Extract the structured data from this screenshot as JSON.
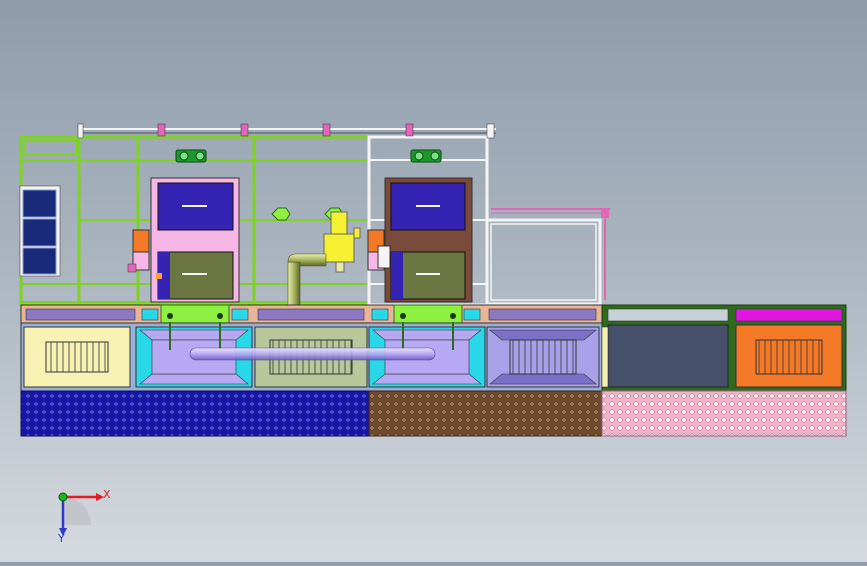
{
  "view": {
    "background_top": "#8e9cab",
    "background_bottom": "#d6dadf"
  },
  "triad": {
    "x_label": "X",
    "y_label": "Y",
    "x_color": "#e02020",
    "y_color": "#2a3bd0",
    "origin_color": "#1fb31f"
  },
  "colors": {
    "frame_green": "#7ed321",
    "frame_dark_green": "#2e6b1e",
    "frame_white": "#f4f4f4",
    "frame_pink": "#e066b8",
    "base_blue": "#1616a8",
    "base_brown": "#6e4a2e",
    "base_pink": "#f0b4c8",
    "panel_violet": "#3524b4",
    "panel_olive": "#6b7642",
    "cabinet_pink": "#f7b7e6",
    "cabinet_brown": "#7a4a3a",
    "module_yellow": "#f7f2b4",
    "module_lavender": "#b6a8f2",
    "module_olive": "#b8c89a",
    "module_slate": "#46506a",
    "module_orange": "#f57a28",
    "accent_magenta": "#e017e0",
    "accent_lime": "#8ef040",
    "accent_cyan": "#28d8e8",
    "duct_olive": "#a9b460",
    "valve_yellow": "#f5f032"
  }
}
